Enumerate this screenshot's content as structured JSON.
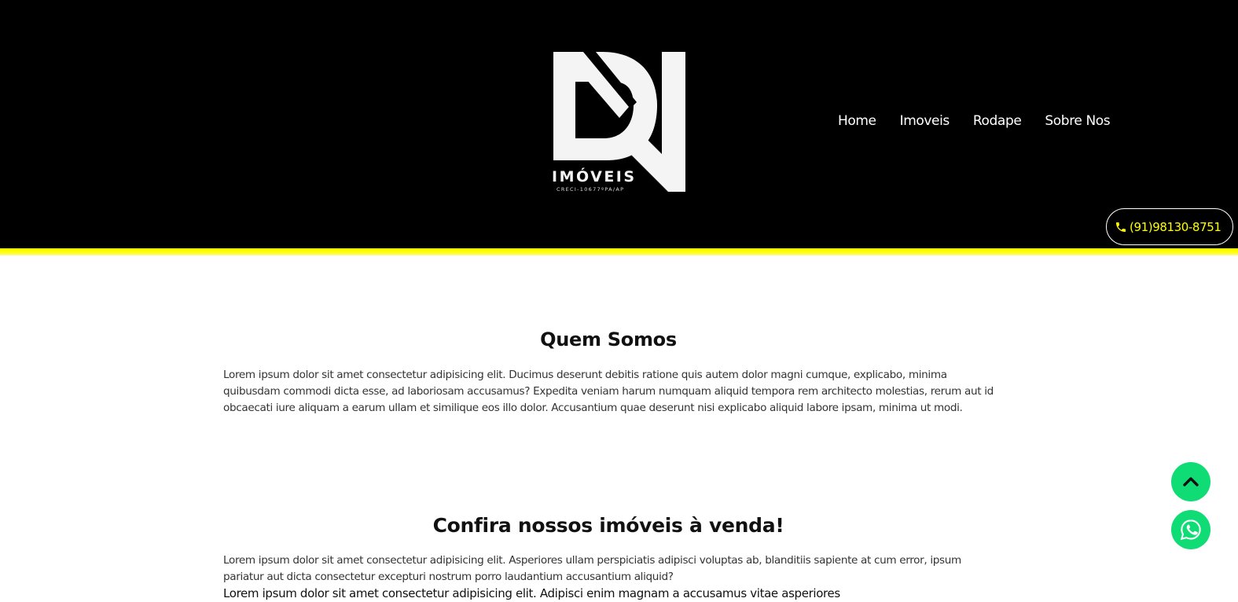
{
  "header": {
    "logo": {
      "wordmark": "IMÓVEIS",
      "creci": "CRECI-10677ºPA/AP"
    },
    "nav": {
      "home": "Home",
      "imoveis": "Imoveis",
      "rodape": "Rodape",
      "sobre_nos": "Sobre Nos"
    },
    "phone": "(91)98130-8751"
  },
  "about": {
    "title": "Quem Somos",
    "text": "Lorem ipsum dolor sit amet consectetur adipisicing elit. Ducimus deserunt debitis ratione quis autem dolor magni cumque, explicabo, minima quibusdam commodi dicta esse, ad laboriosam accusamus? Expedita veniam harum numquam aliquid tempora rem architecto molestias, rerum aut id obcaecati iure aliquam a earum ullam et similique eos illo dolor. Accusantium quae deserunt nisi explicabo aliquid labore ipsam, minima ut modi."
  },
  "listings": {
    "title": "Confira nossos imóveis à venda!",
    "text": "Lorem ipsum dolor sit amet consectetur adipisicing elit. Asperiores ullam perspiciatis adipisci voluptas ab, blanditiis sapiente at cum error, ipsum pariatur aut dicta consectetur excepturi nostrum porro laudantium accusantium aliquid?",
    "text_2": "Lorem ipsum dolor sit amet consectetur adipisicing elit. Adipisci enim magnam a accusamus vitae asperiores"
  },
  "colors": {
    "header_bg": "#000000",
    "accent": "#ffff00",
    "fab": "#0fdc74"
  },
  "icons": {
    "phone": "phone-icon",
    "scroll_top": "chevron-up-icon",
    "whatsapp": "whatsapp-icon"
  }
}
